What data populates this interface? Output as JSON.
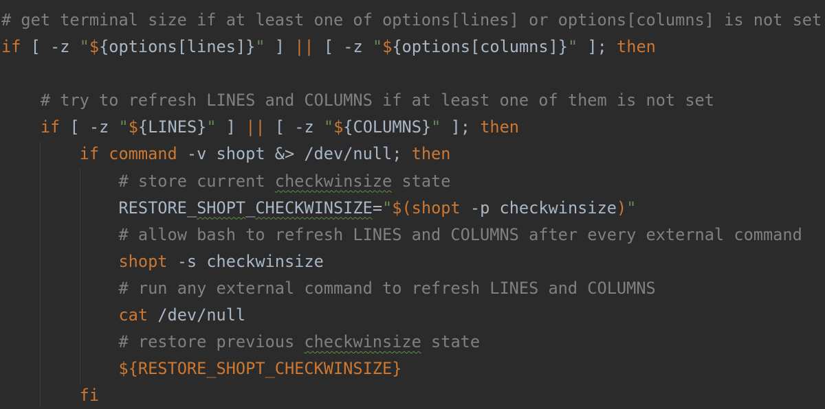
{
  "editor": {
    "language": "bash",
    "colors": {
      "background": "#2b2b2b",
      "comment": "#808080",
      "keyword": "#cc7832",
      "text": "#a9b7c6",
      "string": "#6a8759",
      "typo_underline": "#5f8f45"
    },
    "lines": [
      [
        [
          "c",
          "# get terminal size if at least one of options[lines] or options[columns] is not set"
        ]
      ],
      [
        [
          "k",
          "if"
        ],
        [
          "t",
          " [ -z "
        ],
        [
          "s",
          "\""
        ],
        [
          "d",
          "$"
        ],
        [
          "t",
          "{options[lines]}"
        ],
        [
          "s",
          "\""
        ],
        [
          "t",
          " ] "
        ],
        [
          "k",
          "||"
        ],
        [
          "t",
          " [ -z "
        ],
        [
          "s",
          "\""
        ],
        [
          "d",
          "$"
        ],
        [
          "t",
          "{options[columns]}"
        ],
        [
          "s",
          "\""
        ],
        [
          "t",
          " ]; "
        ],
        [
          "k",
          "then"
        ]
      ],
      [],
      [
        [
          "t",
          "    "
        ],
        [
          "c",
          "# try to refresh LINES and COLUMNS if at least one of them is not set"
        ]
      ],
      [
        [
          "t",
          "    "
        ],
        [
          "k",
          "if"
        ],
        [
          "t",
          " [ -z "
        ],
        [
          "s",
          "\""
        ],
        [
          "d",
          "$"
        ],
        [
          "t",
          "{LINES}"
        ],
        [
          "s",
          "\""
        ],
        [
          "t",
          " ] "
        ],
        [
          "k",
          "||"
        ],
        [
          "t",
          " [ -z "
        ],
        [
          "s",
          "\""
        ],
        [
          "d",
          "$"
        ],
        [
          "t",
          "{COLUMNS}"
        ],
        [
          "s",
          "\""
        ],
        [
          "t",
          " ]; "
        ],
        [
          "k",
          "then"
        ]
      ],
      [
        [
          "t",
          "        "
        ],
        [
          "k",
          "if command"
        ],
        [
          "t",
          " -v shopt &> /dev/null; "
        ],
        [
          "k",
          "then"
        ]
      ],
      [
        [
          "t",
          "            "
        ],
        [
          "c",
          "# store current "
        ],
        [
          "cw",
          "checkwinsize"
        ],
        [
          "c",
          " state"
        ]
      ],
      [
        [
          "t",
          "            RESTORE_"
        ],
        [
          "tw",
          "SHOPT"
        ],
        [
          "t",
          "_"
        ],
        [
          "tw",
          "CHECKWINSIZE"
        ],
        [
          "t",
          "="
        ],
        [
          "s",
          "\""
        ],
        [
          "d",
          "$("
        ],
        [
          "k",
          "shopt"
        ],
        [
          "t",
          " -p checkwinsize"
        ],
        [
          "d",
          ")"
        ],
        [
          "s",
          "\""
        ]
      ],
      [
        [
          "t",
          "            "
        ],
        [
          "c",
          "# allow bash to refresh LINES and COLUMNS after every external command"
        ]
      ],
      [
        [
          "t",
          "            "
        ],
        [
          "k",
          "shopt"
        ],
        [
          "t",
          " -s checkwinsize"
        ]
      ],
      [
        [
          "t",
          "            "
        ],
        [
          "c",
          "# run any external command to refresh LINES and COLUMNS"
        ]
      ],
      [
        [
          "t",
          "            "
        ],
        [
          "k",
          "cat"
        ],
        [
          "t",
          " /dev/null"
        ]
      ],
      [
        [
          "t",
          "            "
        ],
        [
          "c",
          "# restore previous "
        ],
        [
          "cw",
          "checkwinsize"
        ],
        [
          "c",
          " state"
        ]
      ],
      [
        [
          "t",
          "            "
        ],
        [
          "d",
          "${RESTORE_SHOPT_CHECKWINSIZE}"
        ]
      ],
      [
        [
          "t",
          "        "
        ],
        [
          "k",
          "fi"
        ]
      ]
    ]
  }
}
